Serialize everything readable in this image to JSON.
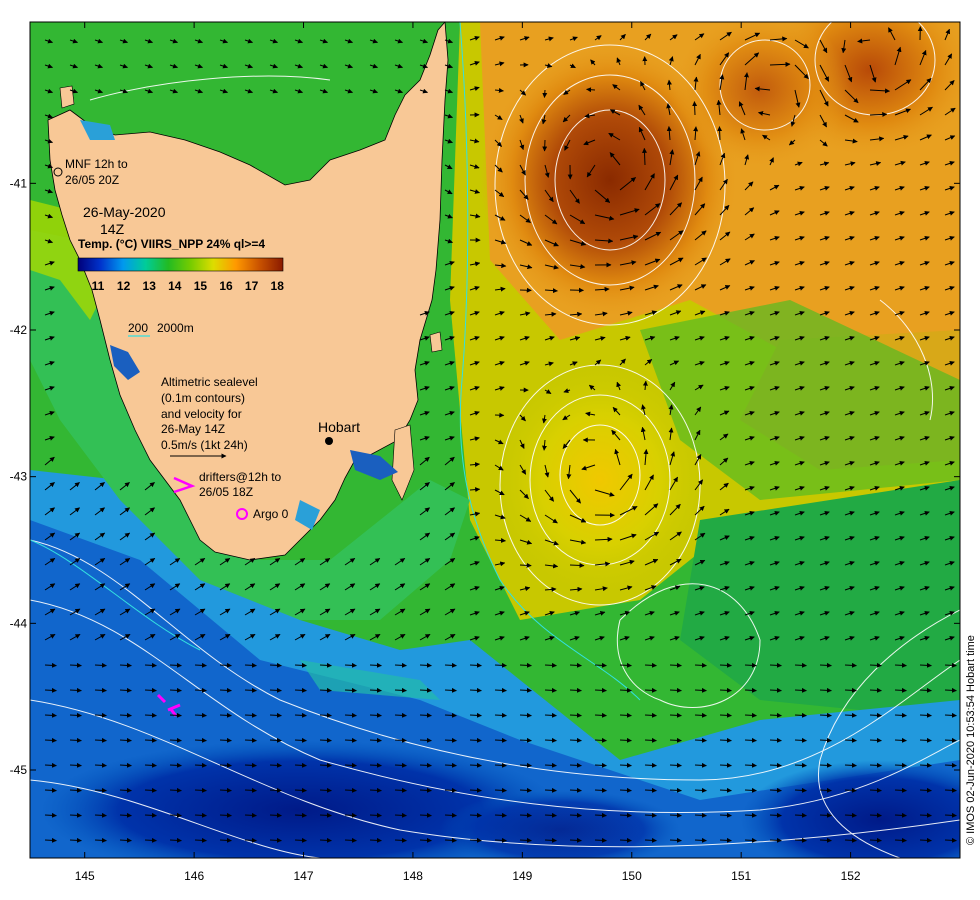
{
  "map": {
    "x_ticks": [
      "145",
      "146",
      "147",
      "148",
      "149",
      "150",
      "151",
      "152"
    ],
    "y_ticks": [
      "-41",
      "-42",
      "-43",
      "-44",
      "-45"
    ],
    "x_range": [
      144.5,
      153.0
    ],
    "y_range": [
      -45.6,
      -39.9
    ]
  },
  "legend": {
    "mnf_line1": "MNF 12h to",
    "mnf_line2": "26/05 20Z",
    "date": "26-May-2020",
    "time": "14Z",
    "temp_title": "Temp. (°C) VIIRS_NPP 24% ql>=4",
    "colorbar_ticks": [
      "11",
      "12",
      "13",
      "14",
      "15",
      "16",
      "17",
      "18"
    ],
    "contour_200": "200",
    "contour_2000": "2000m",
    "altimetry_lines": [
      "Altimetric sealevel",
      "(0.1m contours)",
      "and velocity for",
      "26-May 14Z",
      "0.5m/s (1kt 24h)"
    ],
    "drifters_line1": "drifters@12h to",
    "drifters_line2": "26/05 18Z",
    "argo": "Argo 0",
    "city": "Hobart"
  },
  "credit": "© IMOS 02-Jun-2020 10:53:54 Hobart time",
  "colors": {
    "land": "#f8c896",
    "arrow": "#000000",
    "contour": "#ffffff",
    "drifter": "#ff00ff",
    "colorbar": [
      "#00007a",
      "#0033cc",
      "#0099ee",
      "#00cc99",
      "#22bb22",
      "#77cc00",
      "#dddd00",
      "#ff9900",
      "#cc5500",
      "#8a1a00"
    ]
  }
}
